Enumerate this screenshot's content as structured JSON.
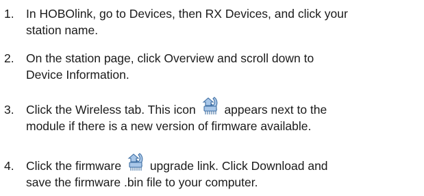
{
  "steps": [
    {
      "number": "1.",
      "line1": "In HOBOlink, go to Devices, then RX Devices, and click your",
      "line2": "station name."
    },
    {
      "number": "2.",
      "line1": "On the station page, click Overview and scroll down to",
      "line2": "Device Information."
    },
    {
      "number": "3.",
      "line1_before_icon": "Click the Wireless tab. This icon",
      "line1_after_icon": "appears next to the",
      "line2": "module if there is a new version of firmware available.",
      "icon": "firmware-upgrade-icon"
    },
    {
      "number": "4.",
      "line1_before_icon": "Click the firmware",
      "line1_after_icon": "upgrade link. Click Download and",
      "line2": "save the firmware .bin file to your computer.",
      "icon": "firmware-upgrade-icon"
    }
  ],
  "colors": {
    "text": "#1a1a1a",
    "icon_fill": "#a9c7e8",
    "icon_stroke": "#3f6fa3"
  }
}
